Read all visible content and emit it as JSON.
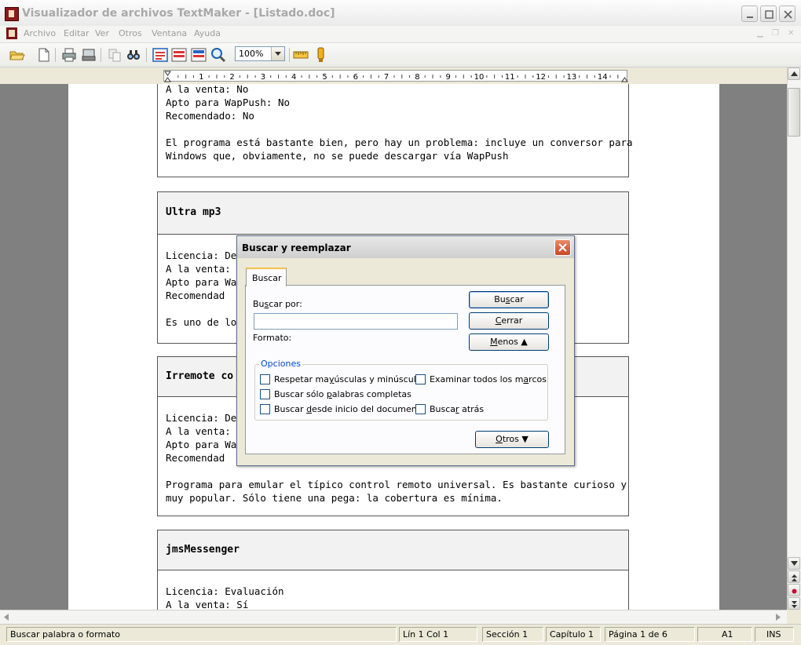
{
  "window": {
    "title": "Visualizador de archivos TextMaker - [Listado.doc]"
  },
  "menu": {
    "items": [
      "Archivo",
      "Editar",
      "Ver",
      "Otros",
      "Ventana",
      "Ayuda"
    ]
  },
  "toolbar": {
    "zoom_value": "100%",
    "icons": [
      "open-folder-icon",
      "new-document-icon",
      "print-icon",
      "print-preview-icon",
      "copy-icon",
      "find-icon",
      "view-normal-icon",
      "view-outline-icon",
      "view-page-icon",
      "zoom-icon",
      "ruler-toggle-icon",
      "info-icon"
    ]
  },
  "ruler": {
    "labels": [
      "1",
      "2",
      "3",
      "4",
      "5",
      "6",
      "7",
      "8",
      "9",
      "10",
      "11",
      "12",
      "13",
      "14"
    ]
  },
  "document": {
    "block0": {
      "lines": [
        "A la venta: No",
        "Apto para WapPush: No",
        "Recomendado: No"
      ],
      "paragraph": [
        "El programa está bastante bien, pero hay un problema: incluye un conversor para",
        "Windows que, obviamente, no se puede descargar vía WapPush"
      ]
    },
    "block1": {
      "heading": "Ultra mp3",
      "lines": [
        "Licencia: Der",
        "A la venta: N",
        "Apto para Wa",
        "Recomendad"
      ],
      "paragraph": [
        "Es uno de los"
      ]
    },
    "block2": {
      "heading": "Irremote co",
      "lines": [
        "Licencia: Der",
        "A la venta: N",
        "Apto para Wa",
        "Recomendad"
      ],
      "paragraph": [
        "Programa para emular el típico control remoto universal. Es bastante curioso y",
        "muy popular. Sólo tiene una pega: la cobertura es mínima."
      ]
    },
    "block3": {
      "heading": "jmsMessenger",
      "lines": [
        "Licencia: Evaluación",
        "A la venta: Sí"
      ]
    }
  },
  "dialog": {
    "title": "Buscar y reemplazar",
    "tab": "Buscar",
    "search_label": "Buscar por:",
    "search_value": "",
    "format_label": "Formato:",
    "buttons": {
      "search": "Buscar",
      "close": "Cerrar",
      "less": "Menos",
      "others": "Otros"
    },
    "options": {
      "legend": "Opciones",
      "case": "Respetar mayúsculas y minúsculas",
      "all_frames": "Examinar todos los marcos",
      "whole_words": "Buscar sólo palabras completas",
      "from_start": "Buscar desde inicio del documento",
      "backwards": "Buscar atrás"
    }
  },
  "status": {
    "message": "Buscar palabra o formato",
    "line_col": "Lín 1 Col 1",
    "section": "Sección 1",
    "chapter": "Capítulo 1",
    "page": "Página 1 de 6",
    "cell": "A1",
    "mode": "INS"
  }
}
